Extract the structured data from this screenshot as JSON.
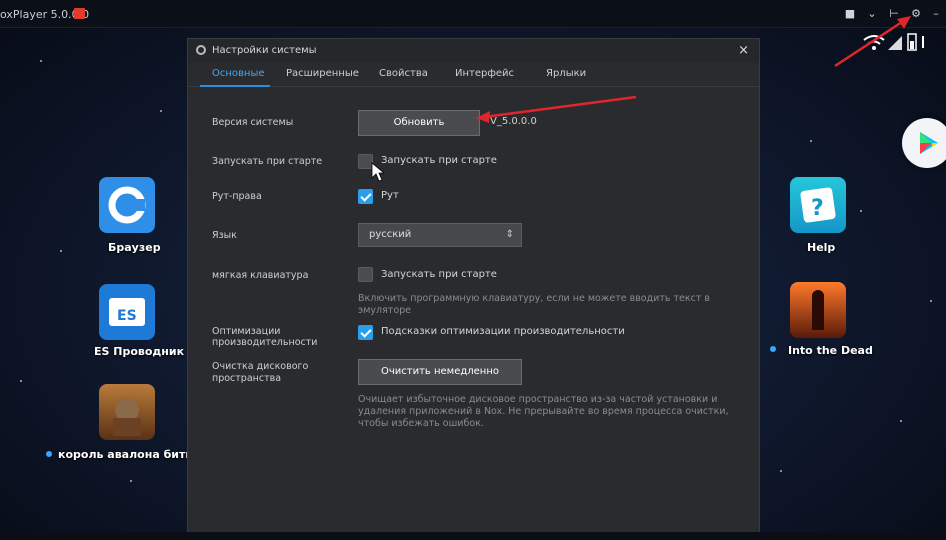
{
  "titlebar": {
    "app_title": "oxPlayer 5.0.0.0"
  },
  "titlebar_icons": [
    "shirt-icon",
    "chevron-down-icon",
    "pin-icon",
    "gear-icon",
    "minimize-icon"
  ],
  "desktop": {
    "left_icons": [
      {
        "label": "Браузер"
      },
      {
        "label": "ES Проводник"
      },
      {
        "label": "король авалона битва дра"
      }
    ],
    "right_icons": [
      {
        "label": "Help"
      },
      {
        "label": "Into the Dead"
      }
    ]
  },
  "dialog": {
    "title": "Настройки системы",
    "tabs": [
      {
        "label": "Основные",
        "active": true
      },
      {
        "label": "Расширенные"
      },
      {
        "label": "Свойства"
      },
      {
        "label": "Интерфейс"
      },
      {
        "label": "Ярлыки"
      }
    ],
    "rows": {
      "system_version": {
        "label": "Версия системы",
        "button": "Обновить",
        "version": "V_5.0.0.0"
      },
      "autostart": {
        "label": "Запускать при старте",
        "checkbox_label": "Запускать при старте",
        "checked": false
      },
      "root": {
        "label": "Рут-права",
        "checkbox_label": "Рут",
        "checked": true
      },
      "language": {
        "label": "Язык",
        "value": "русский"
      },
      "soft_keyboard": {
        "label": "мягкая клавиатура",
        "checkbox_label": "Запускать при старте",
        "checked": false,
        "hint": [
          "Включить программную клавиатуру, если не можете вводить текст в",
          "эмуляторе"
        ]
      },
      "optimization": {
        "label": [
          "Оптимизации",
          "производительности"
        ],
        "checkbox_label": "Подсказки оптимизации производительности",
        "checked": true
      },
      "disk_cleanup": {
        "label": [
          "Очистка дискового",
          "пространства"
        ],
        "button": "Очистить немедленно",
        "hint": [
          "Очищает избыточное дисковое пространство из-за частой установки и",
          "удаления приложений в Nox. Не прерывайте во время процесса очистки,",
          "чтобы избежать ошибок."
        ]
      }
    }
  },
  "colors": {
    "accent": "#2c9ee9",
    "annotation_arrow": "#e0262b",
    "dialog_bg": "#2a2b2e"
  }
}
